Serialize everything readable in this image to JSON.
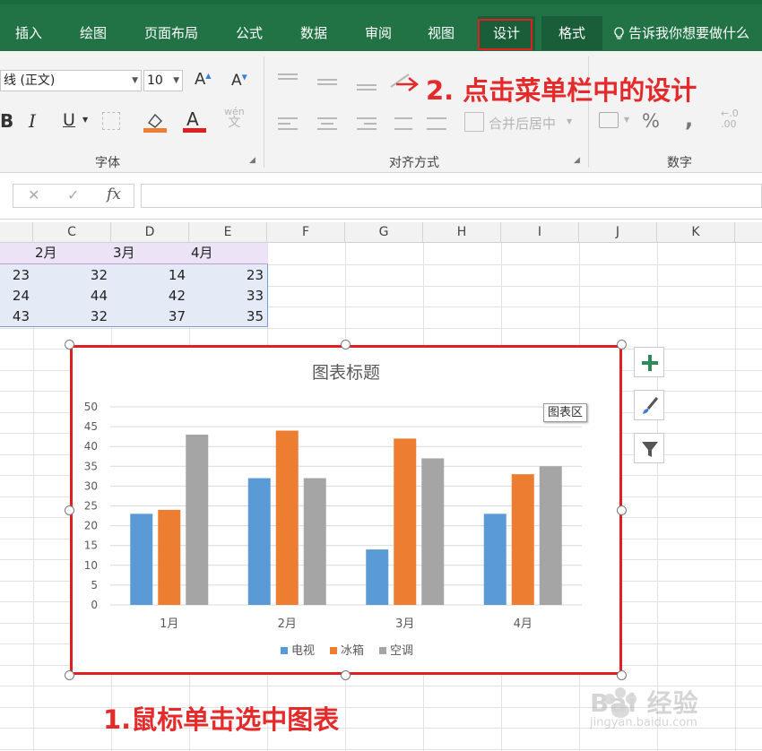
{
  "ribbon_tabs": [
    {
      "label": "插入"
    },
    {
      "label": "绘图"
    },
    {
      "label": "页面布局"
    },
    {
      "label": "公式"
    },
    {
      "label": "数据"
    },
    {
      "label": "审阅"
    },
    {
      "label": "视图"
    },
    {
      "label": "设计"
    },
    {
      "label": "格式"
    }
  ],
  "tell_me": "告诉我你想要做什么",
  "font": {
    "name": "线 (正文)",
    "size": "10",
    "group_label": "字体",
    "wen_label": "wén",
    "wen_char": "文"
  },
  "alignment": {
    "merge_label": "合并后居中",
    "group_label": "对齐方式"
  },
  "number": {
    "percent": "%",
    "comma": ",",
    "group_label": "数字"
  },
  "formula_bar": {
    "cancel": "✕",
    "enter": "✓",
    "fx": "fx",
    "content": ""
  },
  "columns": [
    "C",
    "D",
    "E",
    "F",
    "G",
    "H",
    "I",
    "J",
    "K"
  ],
  "table": {
    "headers": [
      "2月",
      "3月",
      "4月"
    ],
    "rows": [
      [
        "23",
        "32",
        "14",
        "23"
      ],
      [
        "24",
        "44",
        "42",
        "33"
      ],
      [
        "43",
        "32",
        "37",
        "35"
      ]
    ]
  },
  "annotations": {
    "step2": "2. 点击菜单栏中的设计",
    "step1": "1.鼠标单击选中图表"
  },
  "chart_area_tooltip": "图表区",
  "colors": {
    "tv": "#5b9bd5",
    "fridge": "#ed7d31",
    "ac": "#a5a5a5",
    "ribbon": "#217346",
    "annotation": "#e42a2a"
  },
  "chart_data": {
    "type": "bar",
    "title": "图表标题",
    "categories": [
      "1月",
      "2月",
      "3月",
      "4月"
    ],
    "series": [
      {
        "name": "电视",
        "values": [
          23,
          32,
          14,
          23
        ]
      },
      {
        "name": "冰箱",
        "values": [
          24,
          44,
          42,
          33
        ]
      },
      {
        "name": "空调",
        "values": [
          43,
          32,
          37,
          35
        ]
      }
    ],
    "ylim": [
      0,
      50
    ],
    "yticks": [
      0,
      5,
      10,
      15,
      20,
      25,
      30,
      35,
      40,
      45,
      50
    ],
    "grid": true,
    "legend": "bottom"
  },
  "watermark": {
    "brand": "Bai 经验",
    "url": "jingyan.baidu.com"
  }
}
